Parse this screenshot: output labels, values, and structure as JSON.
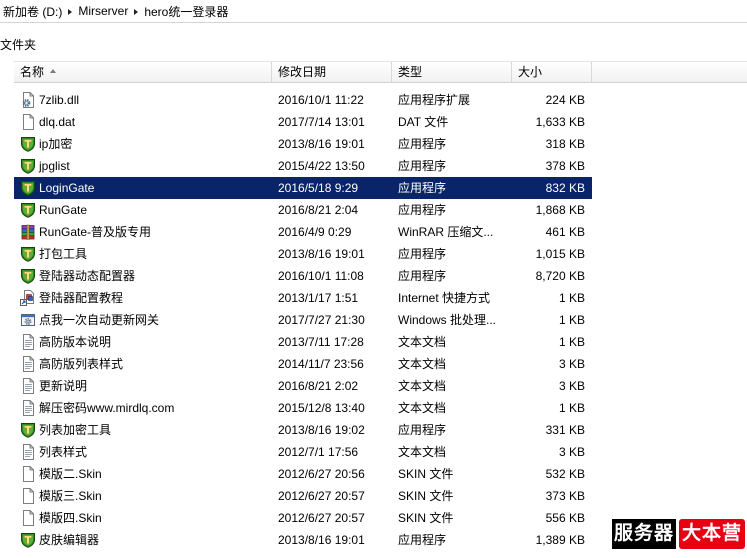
{
  "address_bar": {
    "breadcrumb": [
      {
        "label": "新加卷 (D:)"
      },
      {
        "label": "Mirserver"
      },
      {
        "label": "hero统一登录器"
      }
    ]
  },
  "folders_pane": {
    "label": "文件夹"
  },
  "colors": {
    "selection": "#0a246a"
  },
  "list": {
    "columns": [
      {
        "label": "名称",
        "sort_icon": "sort-ascending-icon"
      },
      {
        "label": "修改日期"
      },
      {
        "label": "类型"
      },
      {
        "label": "大小"
      }
    ],
    "rows": [
      {
        "icon": "dll-file-icon",
        "name": "7zlib.dll",
        "date": "2016/10/1 11:22",
        "type": "应用程序扩展",
        "size": "224 KB"
      },
      {
        "icon": "document-icon",
        "name": "dlq.dat",
        "date": "2017/7/14 13:01",
        "type": "DAT 文件",
        "size": "1,633 KB"
      },
      {
        "icon": "app-shield-icon",
        "name": "ip加密",
        "date": "2013/8/16 19:01",
        "type": "应用程序",
        "size": "318 KB"
      },
      {
        "icon": "app-shield-icon",
        "name": "jpglist",
        "date": "2015/4/22 13:50",
        "type": "应用程序",
        "size": "378 KB"
      },
      {
        "icon": "app-shield-icon",
        "name": "LoginGate",
        "date": "2016/5/18 9:29",
        "type": "应用程序",
        "size": "832 KB",
        "selected": true
      },
      {
        "icon": "app-shield-icon",
        "name": "RunGate",
        "date": "2016/8/21 2:04",
        "type": "应用程序",
        "size": "1,868 KB"
      },
      {
        "icon": "winrar-archive-icon",
        "name": "RunGate-普及版专用",
        "date": "2016/4/9 0:29",
        "type": "WinRAR 压缩文...",
        "size": "461 KB"
      },
      {
        "icon": "app-shield-icon",
        "name": "打包工具",
        "date": "2013/8/16 19:01",
        "type": "应用程序",
        "size": "1,015 KB"
      },
      {
        "icon": "app-shield-icon",
        "name": "登陆器动态配置器",
        "date": "2016/10/1 11:08",
        "type": "应用程序",
        "size": "8,720 KB"
      },
      {
        "icon": "internet-shortcut-icon",
        "name": "登陆器配置教程",
        "date": "2013/1/17 1:51",
        "type": "Internet 快捷方式",
        "size": "1 KB"
      },
      {
        "icon": "batch-file-icon",
        "name": "点我一次自动更新网关",
        "date": "2017/7/27 21:30",
        "type": "Windows 批处理...",
        "size": "1 KB"
      },
      {
        "icon": "text-document-icon",
        "name": "高防版本说明",
        "date": "2013/7/11 17:28",
        "type": "文本文档",
        "size": "1 KB"
      },
      {
        "icon": "text-document-icon",
        "name": "高防版列表样式",
        "date": "2014/11/7 23:56",
        "type": "文本文档",
        "size": "3 KB"
      },
      {
        "icon": "text-document-icon",
        "name": "更新说明",
        "date": "2016/8/21 2:02",
        "type": "文本文档",
        "size": "3 KB"
      },
      {
        "icon": "text-document-icon",
        "name": "解压密码www.mirdlq.com",
        "date": "2015/12/8 13:40",
        "type": "文本文档",
        "size": "1 KB"
      },
      {
        "icon": "app-shield-icon",
        "name": "列表加密工具",
        "date": "2013/8/16 19:02",
        "type": "应用程序",
        "size": "331 KB"
      },
      {
        "icon": "text-document-icon",
        "name": "列表样式",
        "date": "2012/7/1 17:56",
        "type": "文本文档",
        "size": "3 KB"
      },
      {
        "icon": "document-icon",
        "name": "模版二.Skin",
        "date": "2012/6/27 20:56",
        "type": "SKIN 文件",
        "size": "532 KB"
      },
      {
        "icon": "document-icon",
        "name": "模版三.Skin",
        "date": "2012/6/27 20:57",
        "type": "SKIN 文件",
        "size": "373 KB"
      },
      {
        "icon": "document-icon",
        "name": "模版四.Skin",
        "date": "2012/6/27 20:57",
        "type": "SKIN 文件",
        "size": "556 KB"
      },
      {
        "icon": "app-shield-icon",
        "name": "皮肤编辑器",
        "date": "2013/8/16 19:01",
        "type": "应用程序",
        "size": "1,389 KB"
      }
    ]
  },
  "watermark": {
    "left_text": "服务器",
    "right_text": "大本营",
    "left_color": "#000000",
    "right_color": "#e60012"
  }
}
